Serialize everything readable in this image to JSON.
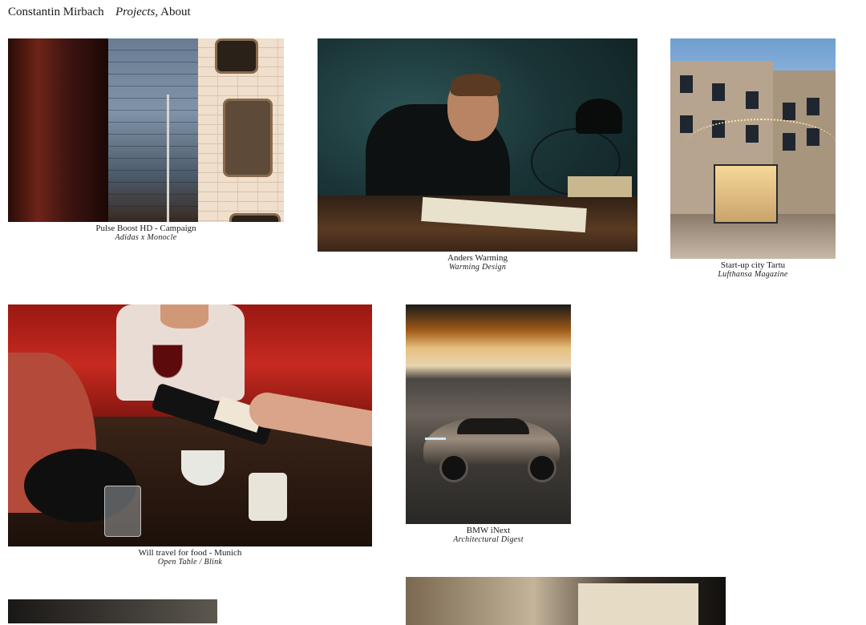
{
  "nav": {
    "brand": "Constantin Mirbach",
    "projects_label": "Projects,",
    "about_label": "About"
  },
  "projects": [
    {
      "title": "Pulse Boost HD - Campaign",
      "subtitle": "Adidas x Monocle"
    },
    {
      "title": "Anders Warming",
      "subtitle": "Warming Design"
    },
    {
      "title": "Start-up city Tartu",
      "subtitle": "Lufthansa Magazine"
    },
    {
      "title": "Will travel for food - Munich",
      "subtitle": "Open Table / Blink"
    },
    {
      "title": "BMW iNext",
      "subtitle": "Architectural Digest"
    }
  ]
}
